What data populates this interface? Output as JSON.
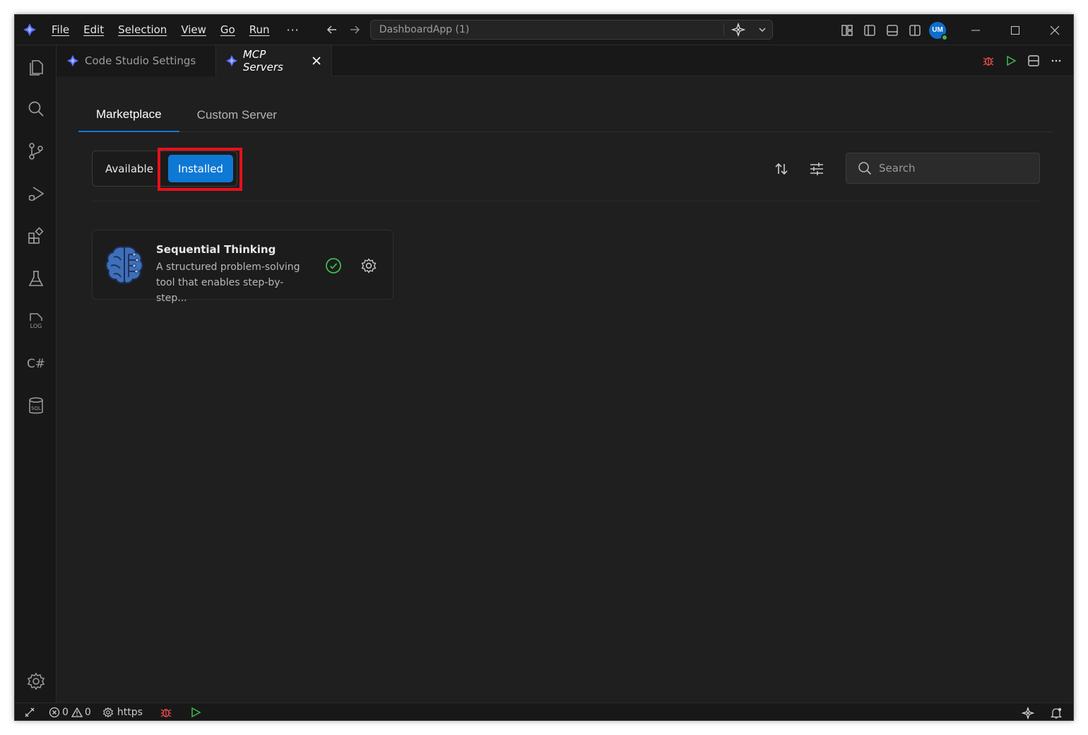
{
  "titlebar": {
    "menu": [
      "File",
      "Edit",
      "Selection",
      "View",
      "Go",
      "Run"
    ],
    "more_label": "···",
    "command_center_text": "DashboardApp (1)",
    "avatar_initials": "UM"
  },
  "tabs": [
    {
      "label": "Code Studio Settings",
      "active": false
    },
    {
      "label": "MCP Servers",
      "active": true
    }
  ],
  "main_tabs": {
    "marketplace": "Marketplace",
    "custom_server": "Custom Server"
  },
  "filter": {
    "available": "Available",
    "installed": "Installed",
    "selected": "Installed"
  },
  "search": {
    "placeholder": "Search",
    "value": ""
  },
  "servers": [
    {
      "name": "Sequential Thinking",
      "description": "A structured problem-solving tool that enables step-by-step...",
      "status": "installed",
      "icon": "brain-circuit-icon"
    }
  ],
  "statusbar": {
    "errors": "0",
    "warnings": "0",
    "profile_label": "https"
  },
  "colors": {
    "accent": "#0e78d5",
    "highlight": "#e8101a",
    "success": "#3fb950",
    "debug": "#f14c4c"
  }
}
